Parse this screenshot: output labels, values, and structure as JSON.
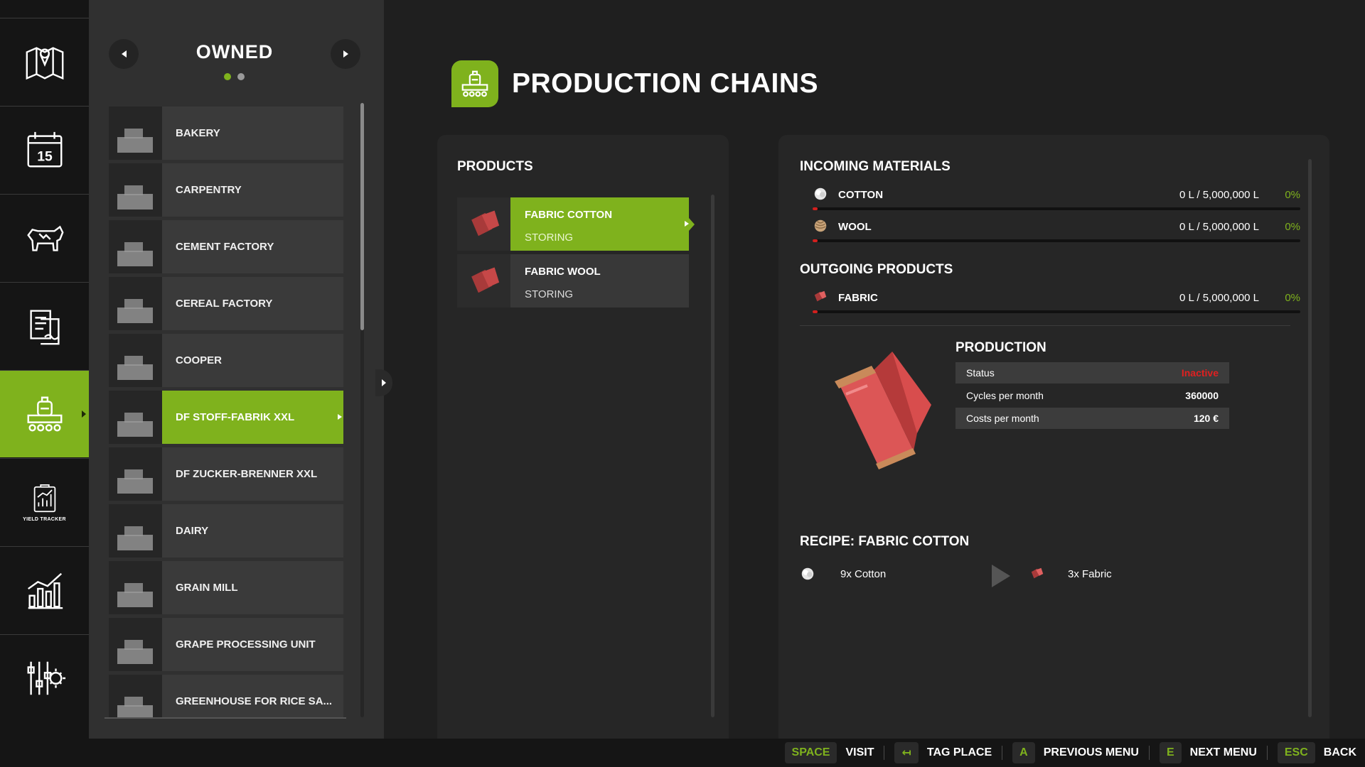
{
  "rail": {
    "items": [
      {
        "icon": "map-icon"
      },
      {
        "icon": "calendar-icon",
        "day": "15"
      },
      {
        "icon": "animals-icon"
      },
      {
        "icon": "contracts-icon"
      },
      {
        "icon": "production-icon",
        "active": true
      },
      {
        "icon": "yield-tracker-icon",
        "caption": "YIELD TRACKER"
      },
      {
        "icon": "statistics-icon"
      },
      {
        "icon": "settings-icon"
      }
    ]
  },
  "places": {
    "title": "OWNED",
    "pages": 2,
    "current_page": 1,
    "items": [
      {
        "name": "BAKERY"
      },
      {
        "name": "CARPENTRY"
      },
      {
        "name": "CEMENT FACTORY"
      },
      {
        "name": "CEREAL FACTORY"
      },
      {
        "name": "COOPER"
      },
      {
        "name": "DF STOFF-FABRIK XXL",
        "active": true
      },
      {
        "name": "DF ZUCKER-BRENNER XXL"
      },
      {
        "name": "DAIRY"
      },
      {
        "name": "GRAIN MILL"
      },
      {
        "name": "GRAPE PROCESSING UNIT"
      },
      {
        "name": "GREENHOUSE FOR RICE SA..."
      }
    ]
  },
  "header": {
    "title": "PRODUCTION CHAINS",
    "icon": "production-icon"
  },
  "products": {
    "title": "PRODUCTS",
    "items": [
      {
        "name": "FABRIC COTTON",
        "state": "STORING",
        "icon": "fabric-icon",
        "active": true
      },
      {
        "name": "FABRIC WOOL",
        "state": "STORING",
        "icon": "fabric-icon"
      }
    ]
  },
  "incoming": {
    "title": "INCOMING MATERIALS",
    "items": [
      {
        "name": "COTTON",
        "amount": "0 L / 5,000,000 L",
        "percent": "0%",
        "fill": 0,
        "icon": "cotton-icon"
      },
      {
        "name": "WOOL",
        "amount": "0 L / 5,000,000 L",
        "percent": "0%",
        "fill": 0,
        "icon": "wool-icon"
      }
    ]
  },
  "outgoing": {
    "title": "OUTGOING PRODUCTS",
    "items": [
      {
        "name": "FABRIC",
        "amount": "0 L / 5,000,000 L",
        "percent": "0%",
        "fill": 0,
        "icon": "fabric-icon"
      }
    ]
  },
  "production": {
    "title": "PRODUCTION",
    "image": "fabric-roll-icon",
    "stats": [
      {
        "label": "Status",
        "value": "Inactive"
      },
      {
        "label": "Cycles per month",
        "value": "360000"
      },
      {
        "label": "Costs per month",
        "value": "120 €"
      }
    ]
  },
  "recipe": {
    "title": "RECIPE: FABRIC COTTON",
    "input": "9x Cotton",
    "output": "3x Fabric"
  },
  "hints": [
    {
      "key": "SPACE",
      "action": "VISIT"
    },
    {
      "key": "↤",
      "action": "TAG PLACE"
    },
    {
      "key": "A",
      "action": "PREVIOUS MENU"
    },
    {
      "key": "E",
      "action": "NEXT MENU"
    },
    {
      "key": "ESC",
      "action": "BACK"
    }
  ],
  "colors": {
    "accent": "#7fb21d",
    "inactive": "#e02020",
    "fabric": "#c94a4a",
    "fill_bar": "#d2201e"
  }
}
